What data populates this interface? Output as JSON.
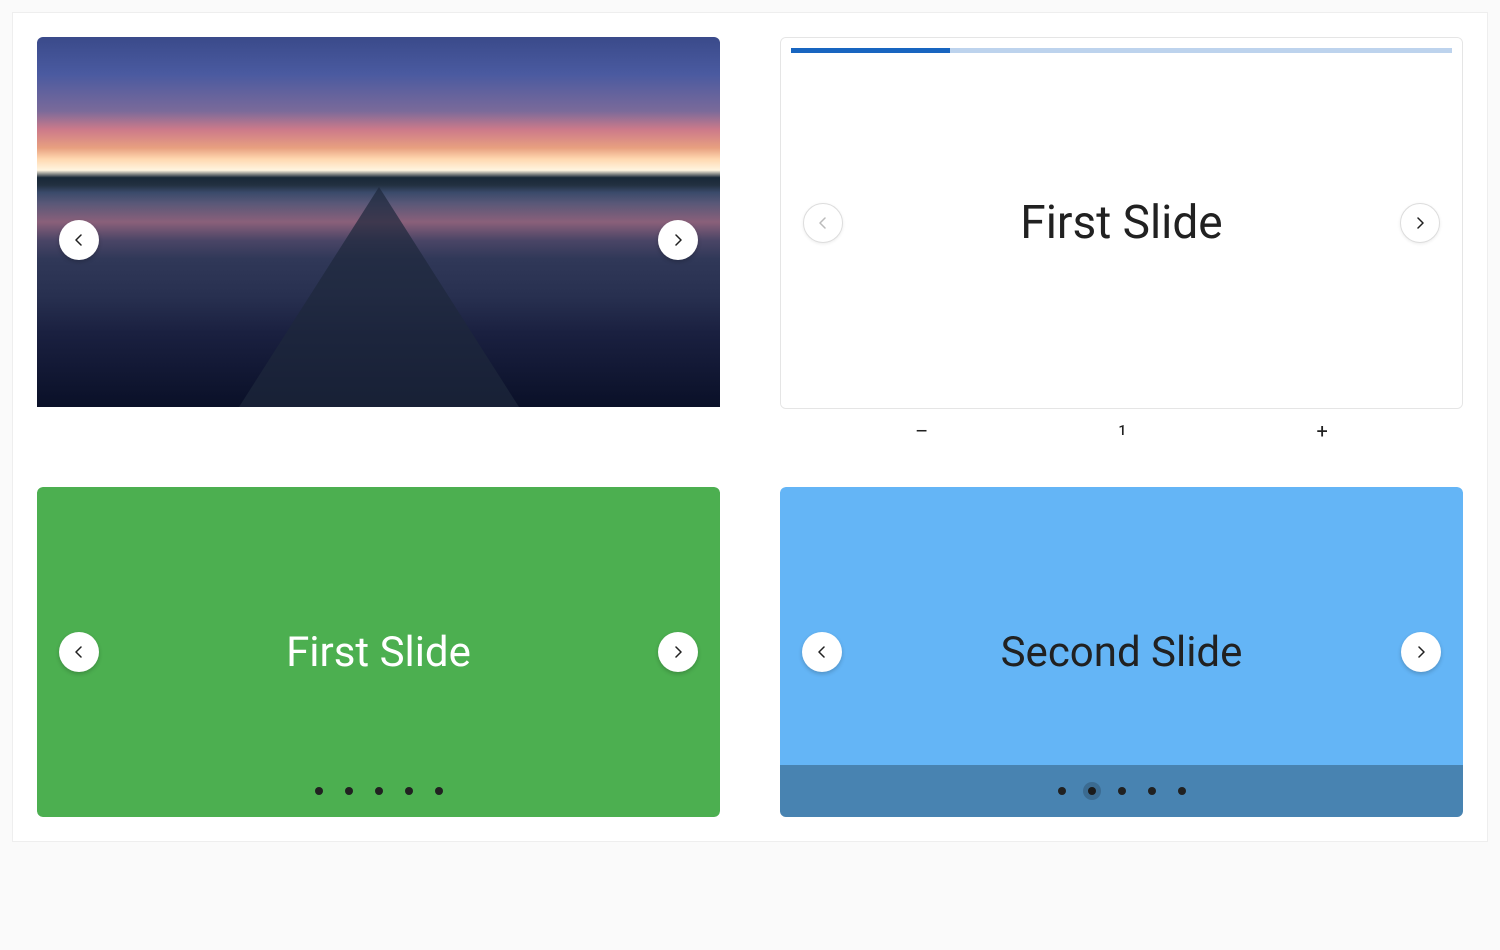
{
  "carousel_image": {
    "alt": "Sunset over lake with wooden pier"
  },
  "carousel_text_top": {
    "title": "First Slide",
    "progress_percent": 24
  },
  "stepper": {
    "minus": "–",
    "value": "1",
    "plus": "+"
  },
  "carousel_green": {
    "title": "First Slide",
    "dot_count": 5,
    "active_index": 0
  },
  "carousel_blue": {
    "title": "Second Slide",
    "dot_count": 5,
    "active_index": 1
  }
}
